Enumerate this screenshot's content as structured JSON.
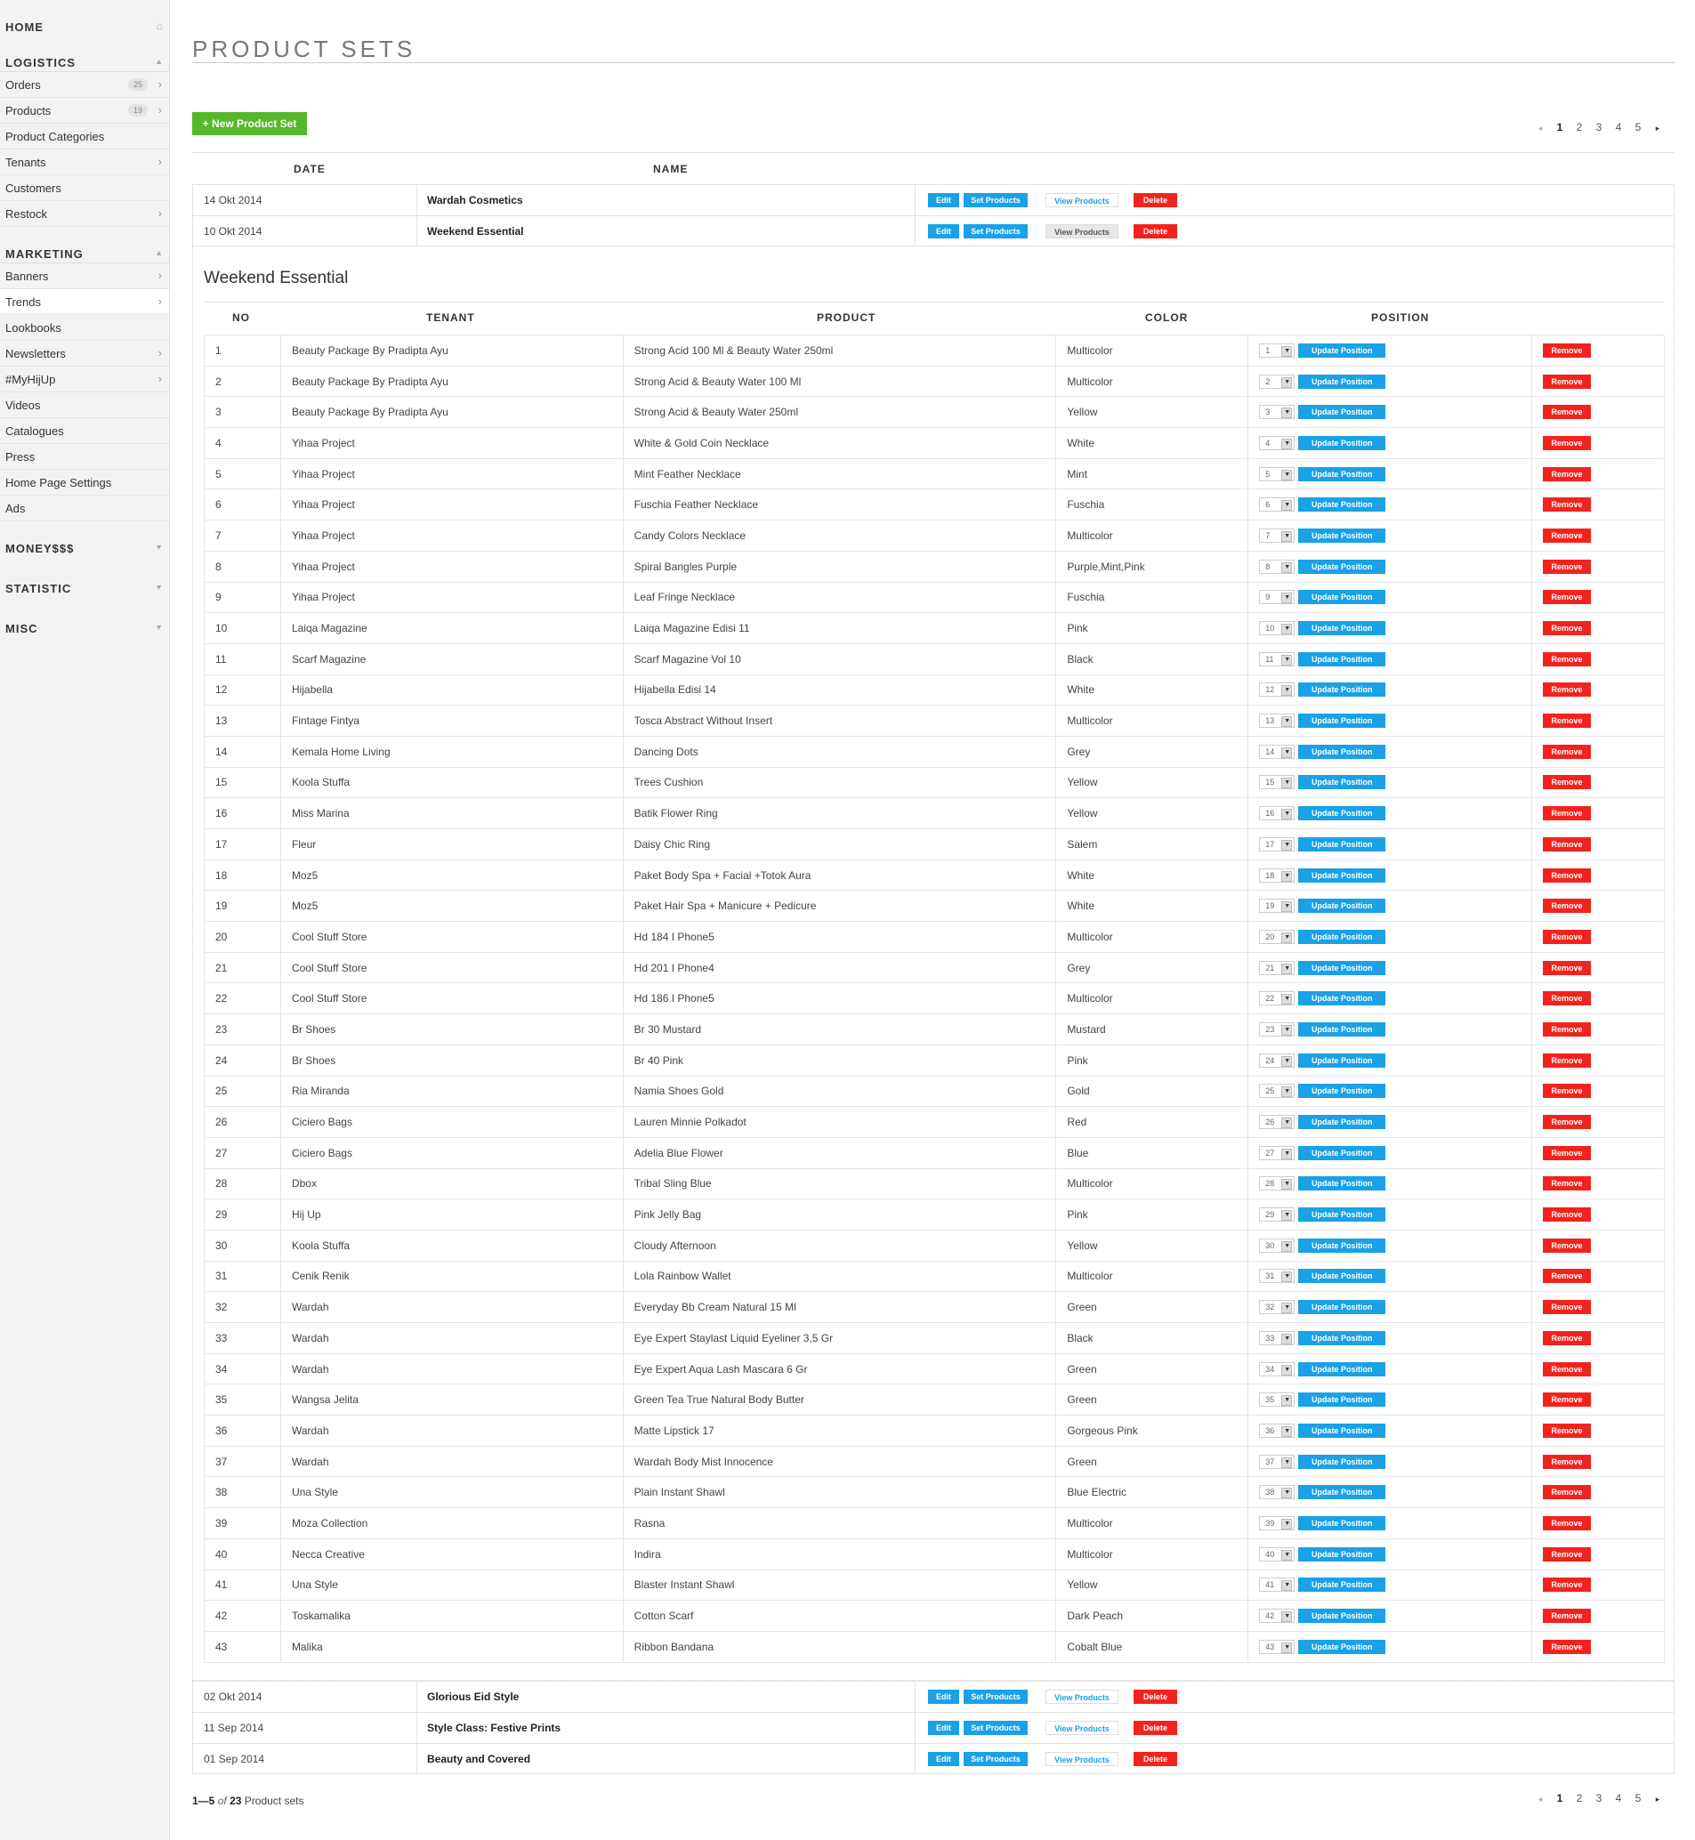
{
  "sidebar": {
    "home": "HOME",
    "logistics": "LOGISTICS",
    "logistics_items": [
      {
        "label": "Orders",
        "count": "25"
      },
      {
        "label": "Products",
        "count": "19"
      },
      {
        "label": "Product Categories",
        "count": ""
      },
      {
        "label": "Tenants",
        "count": ""
      },
      {
        "label": "Customers",
        "count": ""
      },
      {
        "label": "Restock",
        "count": ""
      }
    ],
    "marketing": "MARKETING",
    "marketing_items": [
      {
        "label": "Banners"
      },
      {
        "label": "Trends"
      },
      {
        "label": "Lookbooks"
      },
      {
        "label": "Newsletters"
      },
      {
        "label": "#MyHijUp"
      },
      {
        "label": "Videos"
      },
      {
        "label": "Catalogues"
      },
      {
        "label": "Press"
      },
      {
        "label": "Home Page Settings"
      },
      {
        "label": "Ads"
      }
    ],
    "moneysss": "MONEY$$$",
    "statistic": "STATISTIC",
    "misc": "MISC"
  },
  "page": {
    "title": "PRODUCT SETS",
    "new_button": "+ New Product Set",
    "pagination": {
      "prev": "◂",
      "pages": [
        "1",
        "2",
        "3",
        "4",
        "5"
      ],
      "next": "▸"
    },
    "columns": {
      "date": "DATE",
      "name": "NAME"
    },
    "actions": {
      "edit": "Edit",
      "set_products": "Set Products",
      "view_products": "View Products",
      "delete": "Delete"
    },
    "sets": [
      {
        "date": "14 Okt 2014",
        "name": "Wardah Cosmetics"
      },
      {
        "date": "10 Okt 2014",
        "name": "Weekend Essential"
      },
      {
        "date": "02 Okt 2014",
        "name": "Glorious Eid Style"
      },
      {
        "date": "11 Sep 2014",
        "name": "Style Class: Festive Prints"
      },
      {
        "date": "01 Sep 2014",
        "name": "Beauty and Covered"
      }
    ],
    "footer": {
      "range": "1—5",
      "of": "of",
      "total": "23",
      "suffix": "Product sets"
    }
  },
  "panel": {
    "title": "Weekend Essential",
    "headers": {
      "no": "NO",
      "tenant": "TENANT",
      "product": "PRODUCT",
      "color": "COLOR",
      "position": "POSITION"
    },
    "update_label": "Update Position",
    "remove_label": "Remove",
    "rows": [
      [
        "1",
        "Beauty Package By Pradipta Ayu",
        "Strong Acid 100 Ml & Beauty Water 250ml",
        "Multicolor"
      ],
      [
        "2",
        "Beauty Package By Pradipta Ayu",
        "Strong Acid & Beauty Water 100 Ml",
        "Multicolor"
      ],
      [
        "3",
        "Beauty Package By Pradipta Ayu",
        "Strong Acid & Beauty Water 250ml",
        "Yellow"
      ],
      [
        "4",
        "Yihaa Project",
        "White & Gold Coin Necklace",
        "White"
      ],
      [
        "5",
        "Yihaa Project",
        "Mint Feather Necklace",
        "Mint"
      ],
      [
        "6",
        "Yihaa Project",
        "Fuschia Feather Necklace",
        "Fuschia"
      ],
      [
        "7",
        "Yihaa Project",
        "Candy Colors Necklace",
        "Multicolor"
      ],
      [
        "8",
        "Yihaa Project",
        "Spiral Bangles Purple",
        "Purple,Mint,Pink"
      ],
      [
        "9",
        "Yihaa Project",
        "Leaf Fringe Necklace",
        "Fuschia"
      ],
      [
        "10",
        "Laiqa Magazine",
        "Laiqa Magazine Edisi 11",
        "Pink"
      ],
      [
        "11",
        "Scarf Magazine",
        "Scarf Magazine Vol 10",
        "Black"
      ],
      [
        "12",
        "Hijabella",
        "Hijabella Edisi 14",
        "White"
      ],
      [
        "13",
        "Fintage Fintya",
        "Tosca Abstract Without Insert",
        "Multicolor"
      ],
      [
        "14",
        "Kemala Home Living",
        "Dancing Dots",
        "Grey"
      ],
      [
        "15",
        "Koola Stuffa",
        "Trees Cushion",
        "Yellow"
      ],
      [
        "16",
        "Miss Marina",
        "Batik Flower Ring",
        "Yellow"
      ],
      [
        "17",
        "Fleur",
        "Daisy Chic Ring",
        "Salem"
      ],
      [
        "18",
        "Moz5",
        "Paket Body Spa + Facial +Totok Aura",
        "White"
      ],
      [
        "19",
        "Moz5",
        "Paket Hair Spa + Manicure + Pedicure",
        "White"
      ],
      [
        "20",
        "Cool Stuff Store",
        "Hd 184 I Phone5",
        "Multicolor"
      ],
      [
        "21",
        "Cool Stuff Store",
        "Hd 201 I Phone4",
        "Grey"
      ],
      [
        "22",
        "Cool Stuff Store",
        "Hd 186 I Phone5",
        "Multicolor"
      ],
      [
        "23",
        "Br Shoes",
        "Br 30 Mustard",
        "Mustard"
      ],
      [
        "24",
        "Br Shoes",
        "Br 40 Pink",
        "Pink"
      ],
      [
        "25",
        "Ria Miranda",
        "Namia Shoes Gold",
        "Gold"
      ],
      [
        "26",
        "Ciciero Bags",
        "Lauren Minnie Polkadot",
        "Red"
      ],
      [
        "27",
        "Ciciero Bags",
        "Adelia Blue Flower",
        "Blue"
      ],
      [
        "28",
        "Dbox",
        "Tribal Sling Blue",
        "Multicolor"
      ],
      [
        "29",
        "Hij Up",
        "Pink Jelly Bag",
        "Pink"
      ],
      [
        "30",
        "Koola Stuffa",
        "Cloudy Afternoon",
        "Yellow"
      ],
      [
        "31",
        "Cenik Renik",
        "Lola Rainbow Wallet",
        "Multicolor"
      ],
      [
        "32",
        "Wardah",
        "Everyday Bb Cream Natural 15 Ml",
        "Green"
      ],
      [
        "33",
        "Wardah",
        "Eye Expert Staylast Liquid Eyeliner 3,5 Gr",
        "Black"
      ],
      [
        "34",
        "Wardah",
        "Eye Expert Aqua Lash Mascara 6 Gr",
        "Green"
      ],
      [
        "35",
        "Wangsa Jelita",
        "Green Tea True Natural Body Butter",
        "Green"
      ],
      [
        "36",
        "Wardah",
        "Matte Lipstick 17",
        "Gorgeous Pink"
      ],
      [
        "37",
        "Wardah",
        "Wardah Body Mist Innocence",
        "Green"
      ],
      [
        "38",
        "Una Style",
        "Plain Instant Shawl",
        "Blue Electric"
      ],
      [
        "39",
        "Moza Collection",
        "Rasna",
        "Multicolor"
      ],
      [
        "40",
        "Necca Creative",
        "Indira",
        "Multicolor"
      ],
      [
        "41",
        "Una Style",
        "Blaster Instant Shawl",
        "Yellow"
      ],
      [
        "42",
        "Toskamalika",
        "Cotton Scarf",
        "Dark Peach"
      ],
      [
        "43",
        "Malika",
        "Ribbon Bandana",
        "Cobalt Blue"
      ]
    ]
  },
  "colors": {
    "primary": "#1aa1e6",
    "danger": "#f2231d",
    "success": "#55b82a"
  }
}
